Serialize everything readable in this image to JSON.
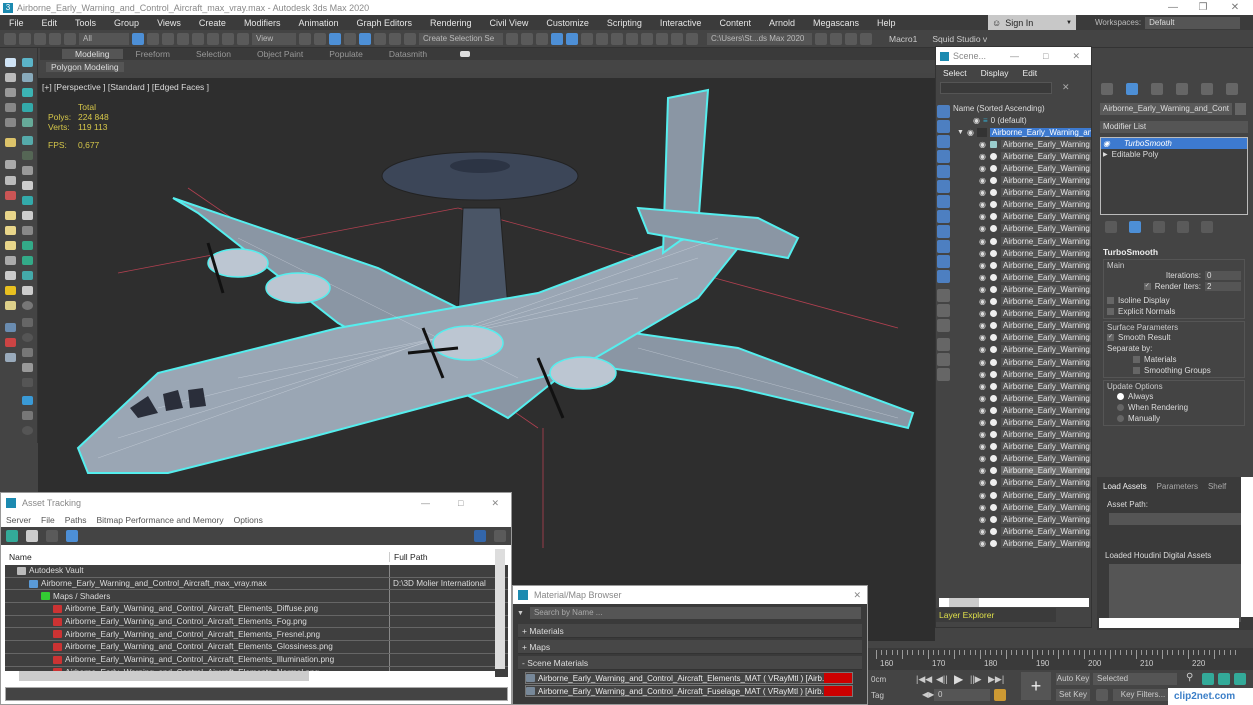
{
  "window": {
    "title": "Airborne_Early_Warning_and_Control_Aircraft_max_vray.max - Autodesk 3ds Max 2020"
  },
  "menu": [
    "File",
    "Edit",
    "Tools",
    "Group",
    "Views",
    "Create",
    "Modifiers",
    "Animation",
    "Graph Editors",
    "Rendering",
    "Civil View",
    "Customize",
    "Scripting",
    "Interactive",
    "Content",
    "Arnold",
    "Megascans",
    "Help"
  ],
  "signin": {
    "label": "Sign In"
  },
  "workspaces": {
    "label": "Workspaces:",
    "value": "Default"
  },
  "toolbar": {
    "filter": "All",
    "view": "View",
    "selection_set": "Create Selection Se",
    "project_path": "C:\\Users\\St...ds Max 2020",
    "macro": "Macro1",
    "studio": "Squid Studio v"
  },
  "ribbon": {
    "tabs": [
      "Modeling",
      "Freeform",
      "Selection",
      "Object Paint",
      "Populate",
      "Datasmith"
    ],
    "active": "Modeling",
    "sub": "Polygon Modeling"
  },
  "viewport": {
    "label": "[+] [Perspective ] [Standard ] [Edged Faces ]",
    "stats": {
      "total_label": "Total",
      "polys_label": "Polys:",
      "polys": "224 848",
      "verts_label": "Verts:",
      "verts": "119 113",
      "fps_label": "FPS:",
      "fps": "0,677"
    }
  },
  "scene_explorer": {
    "title": "Scene...",
    "menu": [
      "Select",
      "Display",
      "Edit"
    ],
    "column": "Name (Sorted Ascending)",
    "layer": "0 (default)",
    "root": "Airborne_Early_Warning_and_Control_Aircraft",
    "child_label": "Airborne_Early_Warning",
    "child_count": 34,
    "highlighted_index": 27,
    "footer": "Layer Explorer"
  },
  "command_panel": {
    "object_name": "Airborne_Early_Warning_and_Cont",
    "modifier_list": "Modifier List",
    "stack": [
      "TurboSmooth",
      "Editable Poly"
    ],
    "rollout": "TurboSmooth",
    "main": {
      "label": "Main",
      "iterations_label": "Iterations:",
      "iterations": "0",
      "render_iters_label": "Render Iters:",
      "render_iters": "2",
      "render_iters_checked": true,
      "isoline": "Isoline Display",
      "explicit": "Explicit Normals"
    },
    "surface": {
      "label": "Surface Parameters",
      "smooth_result": "Smooth Result",
      "separate_by": "Separate by:",
      "materials": "Materials",
      "smoothing_groups": "Smoothing Groups"
    },
    "update": {
      "label": "Update Options",
      "options": [
        "Always",
        "When Rendering",
        "Manually"
      ],
      "selected": "Always"
    }
  },
  "houdini": {
    "tabs": [
      "Load Assets",
      "Parameters",
      "Shelf"
    ],
    "asset_path": "Asset Path:",
    "loaded": "Loaded Houdini Digital Assets"
  },
  "asset_tracking": {
    "title": "Asset Tracking",
    "menu": [
      "Server",
      "File",
      "Paths",
      "Bitmap Performance and Memory",
      "Options"
    ],
    "columns": [
      "Name",
      "Full Path"
    ],
    "rows": [
      {
        "name": "Autodesk Vault",
        "path": "",
        "indent": 1,
        "icon": "vault"
      },
      {
        "name": "Airborne_Early_Warning_and_Control_Aircraft_max_vray.max",
        "path": "D:\\3D Molier International",
        "indent": 2,
        "icon": "max"
      },
      {
        "name": "Maps / Shaders",
        "path": "",
        "indent": 3,
        "icon": "maps"
      },
      {
        "name": "Airborne_Early_Warning_and_Control_Aircraft_Elements_Diffuse.png",
        "path": "",
        "indent": 4,
        "icon": "png"
      },
      {
        "name": "Airborne_Early_Warning_and_Control_Aircraft_Elements_Fog.png",
        "path": "",
        "indent": 4,
        "icon": "png"
      },
      {
        "name": "Airborne_Early_Warning_and_Control_Aircraft_Elements_Fresnel.png",
        "path": "",
        "indent": 4,
        "icon": "png"
      },
      {
        "name": "Airborne_Early_Warning_and_Control_Aircraft_Elements_Glossiness.png",
        "path": "",
        "indent": 4,
        "icon": "png"
      },
      {
        "name": "Airborne_Early_Warning_and_Control_Aircraft_Elements_Illumination.png",
        "path": "",
        "indent": 4,
        "icon": "png"
      },
      {
        "name": "Airborne_Early_Warning_and_Control_Aircraft_Elements_Normal.png",
        "path": "",
        "indent": 4,
        "icon": "png"
      }
    ]
  },
  "material_browser": {
    "title": "Material/Map Browser",
    "search_placeholder": "Search by Name ...",
    "sections": [
      "+ Materials",
      "+ Maps",
      "- Scene Materials"
    ],
    "materials": [
      "Airborne_Early_Warning_and_Control_Aircraft_Elements_MAT ( VRayMtl ) [Airb...",
      "Airborne_Early_Warning_and_Control_Aircraft_Fuselage_MAT ( VRayMtl ) [Airb..."
    ]
  },
  "timeline": {
    "ticks": [
      "160",
      "170",
      "180",
      "190",
      "200",
      "210",
      "220"
    ]
  },
  "animation": {
    "units": "0cm",
    "tag": "Tag",
    "frame": "0",
    "auto_key": "Auto Key",
    "set_key": "Set Key",
    "key_mode": "Selected",
    "key_filters": "Key Filters..."
  },
  "watermark": "clip2net.com"
}
